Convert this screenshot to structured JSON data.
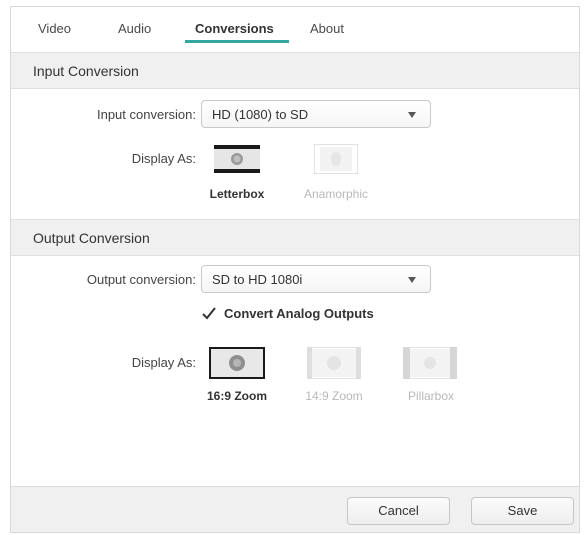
{
  "tabs": [
    {
      "label": "Video"
    },
    {
      "label": "Audio"
    },
    {
      "label": "Conversions"
    },
    {
      "label": "About"
    }
  ],
  "active_tab": "Conversions",
  "accent_color": "#34a8a0",
  "input_section": {
    "title": "Input Conversion",
    "conversion_label": "Input conversion:",
    "conversion_value": "HD (1080) to SD",
    "display_as_label": "Display As:",
    "options": [
      {
        "label": "Letterbox",
        "selected": true,
        "icon": "letterbox-icon"
      },
      {
        "label": "Anamorphic",
        "selected": false,
        "icon": "anamorphic-icon"
      }
    ]
  },
  "output_section": {
    "title": "Output Conversion",
    "conversion_label": "Output conversion:",
    "conversion_value": "SD to HD 1080i",
    "checkbox_label": "Convert Analog Outputs",
    "checkbox_checked": true,
    "display_as_label": "Display As:",
    "options": [
      {
        "label": "16:9 Zoom",
        "selected": true,
        "icon": "zoom-16-9-icon"
      },
      {
        "label": "14:9 Zoom",
        "selected": false,
        "icon": "zoom-14-9-icon"
      },
      {
        "label": "Pillarbox",
        "selected": false,
        "icon": "pillarbox-icon"
      }
    ]
  },
  "footer": {
    "cancel_label": "Cancel",
    "save_label": "Save"
  }
}
